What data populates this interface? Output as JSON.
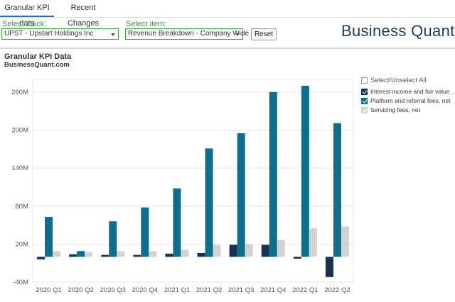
{
  "tabs": [
    {
      "label": "Granular KPI data",
      "active": true
    },
    {
      "label": "Recent Changes",
      "active": false
    }
  ],
  "controls": {
    "stock_label": "Select stock:",
    "stock_value": "UPST - Upstart Holdings Inc",
    "item_label": "Select item:",
    "item_value": "Revenue Breakdown - Company Wide",
    "reset_label": "Reset"
  },
  "brand": {
    "logo_text": "Business Quant"
  },
  "chart": {
    "title": "Granular KPI Data",
    "subtitle": "BusinessQuant.com"
  },
  "legend": {
    "select_all": "Select/Unselect All",
    "items": [
      {
        "label": "Interest income and fair value ...",
        "color": "#17324f",
        "checked": true
      },
      {
        "label": "Platform and referral fees, net",
        "color": "#0d6e8e",
        "checked": true
      },
      {
        "label": "Servicing fees, net",
        "color": "#d3d3d3",
        "checked": true
      }
    ]
  },
  "chart_data": {
    "type": "bar",
    "categories": [
      "2020 Q1",
      "2020 Q2",
      "2020 Q3",
      "2020 Q4",
      "2021 Q1",
      "2021 Q2",
      "2021 Q3",
      "2021 Q4",
      "2022 Q1",
      "2022 Q2"
    ],
    "series": [
      {
        "name": "Interest income and fair value ...",
        "color": "#17324f",
        "values": [
          -4,
          4,
          3,
          3,
          5,
          6,
          19,
          19,
          -3,
          -32
        ]
      },
      {
        "name": "Platform and referral fees, net",
        "color": "#0d6e8e",
        "values": [
          63,
          9,
          56,
          78,
          108,
          171,
          195,
          260,
          270,
          211
        ]
      },
      {
        "name": "Servicing fees, net",
        "color": "#d3d3d3",
        "values": [
          9,
          7,
          9,
          9,
          11,
          19,
          20,
          27,
          45,
          48
        ]
      }
    ],
    "ylim": [
      -40,
      280
    ],
    "yticks": [
      -40,
      20,
      80,
      140,
      200,
      260
    ],
    "ytick_labels": [
      "-40M",
      "20M",
      "80M",
      "140M",
      "200M",
      "260M"
    ],
    "grid": true,
    "legend_position": "right"
  }
}
